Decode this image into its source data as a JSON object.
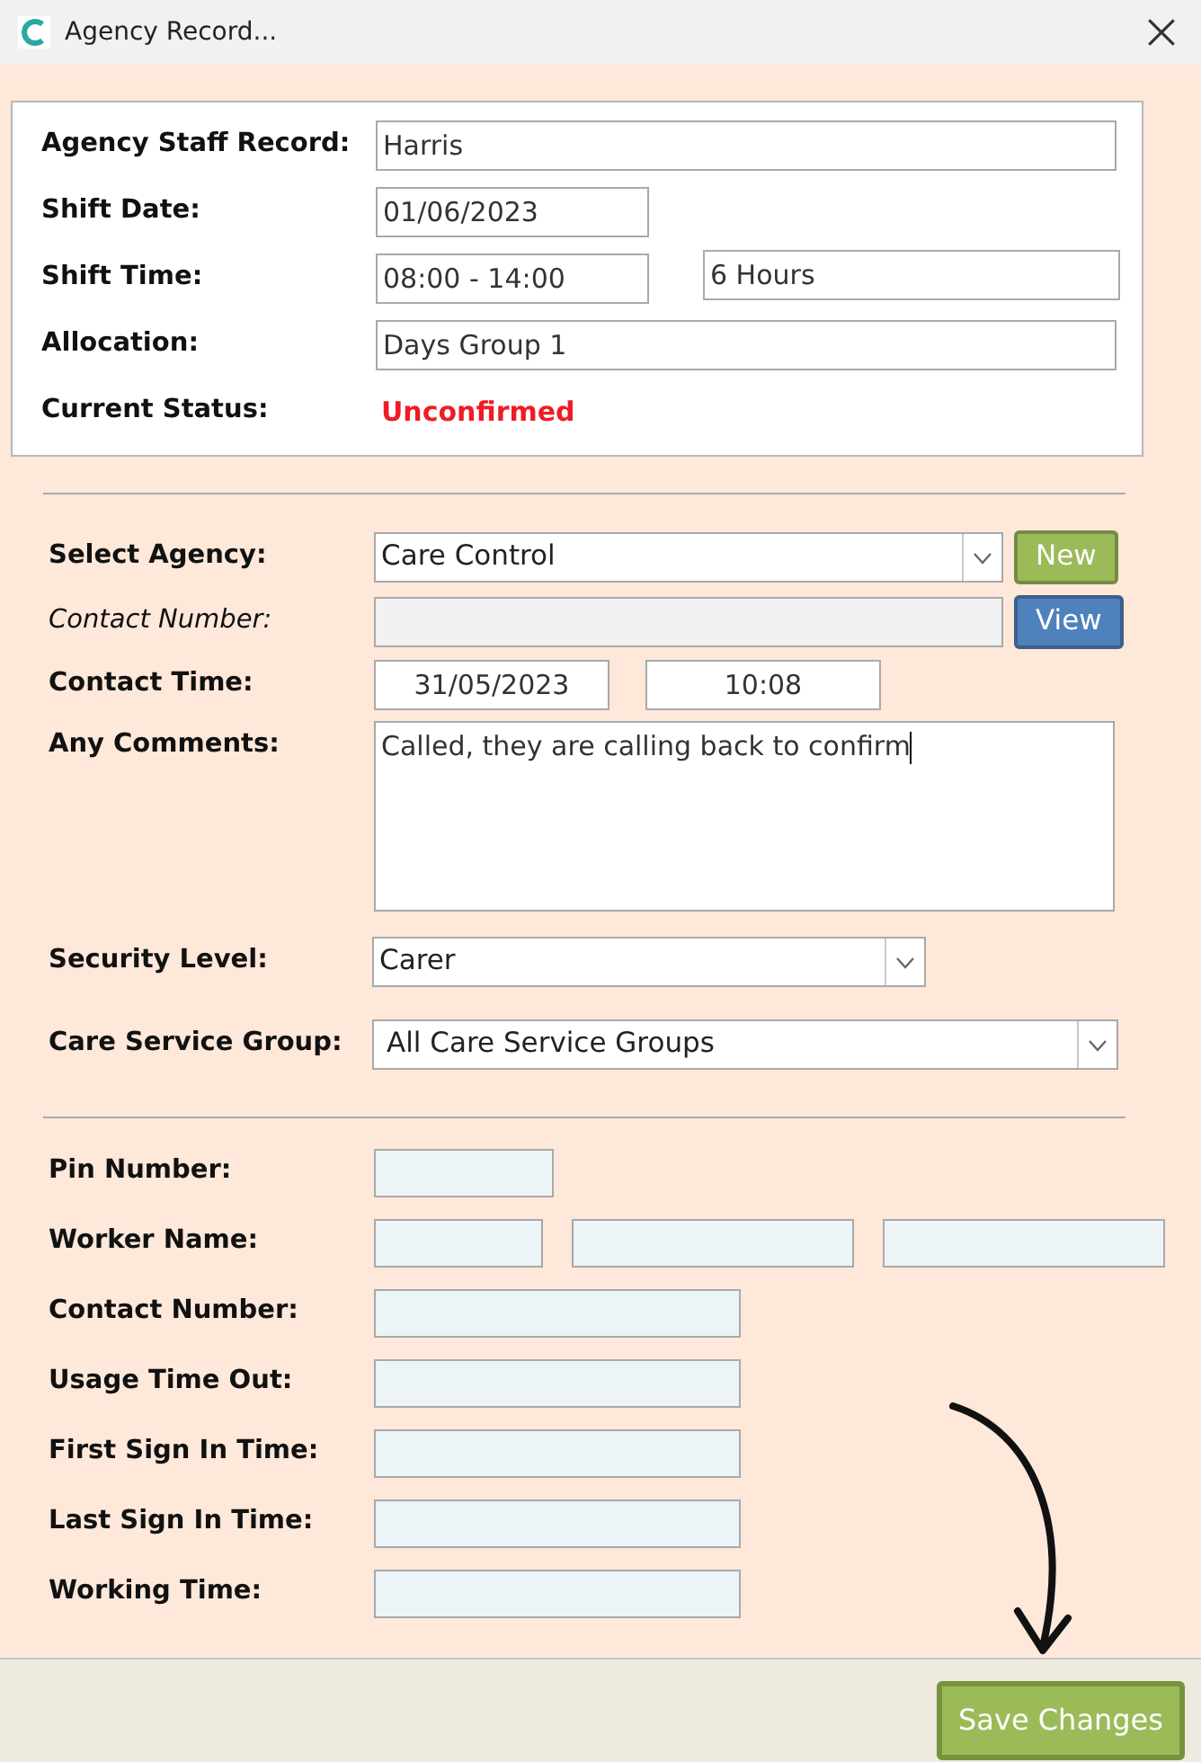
{
  "window": {
    "title": "Agency Record..."
  },
  "record": [
    {
      "label": "Agency Staff Record:",
      "kind": "wide",
      "values": [
        "Harris"
      ]
    },
    {
      "label": "Shift Date:",
      "kind": "date",
      "values": [
        "01/06/2023"
      ]
    },
    {
      "label": "Shift Time:",
      "kind": "pair",
      "values": [
        "08:00 - 14:00",
        "6 Hours"
      ]
    },
    {
      "label": "Allocation:",
      "kind": "wide",
      "values": [
        "Days Group 1"
      ]
    },
    {
      "label": "Current Status:",
      "kind": "status",
      "values": [
        "Unconfirmed"
      ]
    }
  ],
  "agency": [
    {
      "label": "Select Agency:",
      "kind": "select-button",
      "value": "Care Control",
      "button": {
        "label": "New",
        "color": "#9bbb59"
      }
    },
    {
      "label": "Contact Number:",
      "kind": "field-button",
      "disabled": true,
      "italic": true,
      "button": {
        "label": "View",
        "color": "#4f81bd"
      }
    },
    {
      "label": "Contact Time:",
      "kind": "times",
      "values": [
        "31/05/2023",
        "10:08"
      ]
    },
    {
      "label": "Any Comments:",
      "kind": "comments",
      "value": "Called, they are calling back to confirm",
      "focused": true
    },
    {
      "label": "Security Level:",
      "kind": "select-mid",
      "value": "Carer"
    },
    {
      "label": "Care Service Group:",
      "kind": "select-wide",
      "value": "All Care Service Groups"
    }
  ],
  "worker": [
    {
      "label": "Pin Number:",
      "kind": "short"
    },
    {
      "label": "Worker Name:",
      "kind": "name"
    },
    {
      "label": "Contact Number:",
      "kind": "medium"
    },
    {
      "label": "Usage Time Out:",
      "kind": "medium"
    },
    {
      "label": "First Sign In Time:",
      "kind": "medium"
    },
    {
      "label": "Last Sign In Time:",
      "kind": "medium"
    },
    {
      "label": "Working Time:",
      "kind": "medium"
    }
  ],
  "footer": {
    "button": "Save Changes"
  }
}
